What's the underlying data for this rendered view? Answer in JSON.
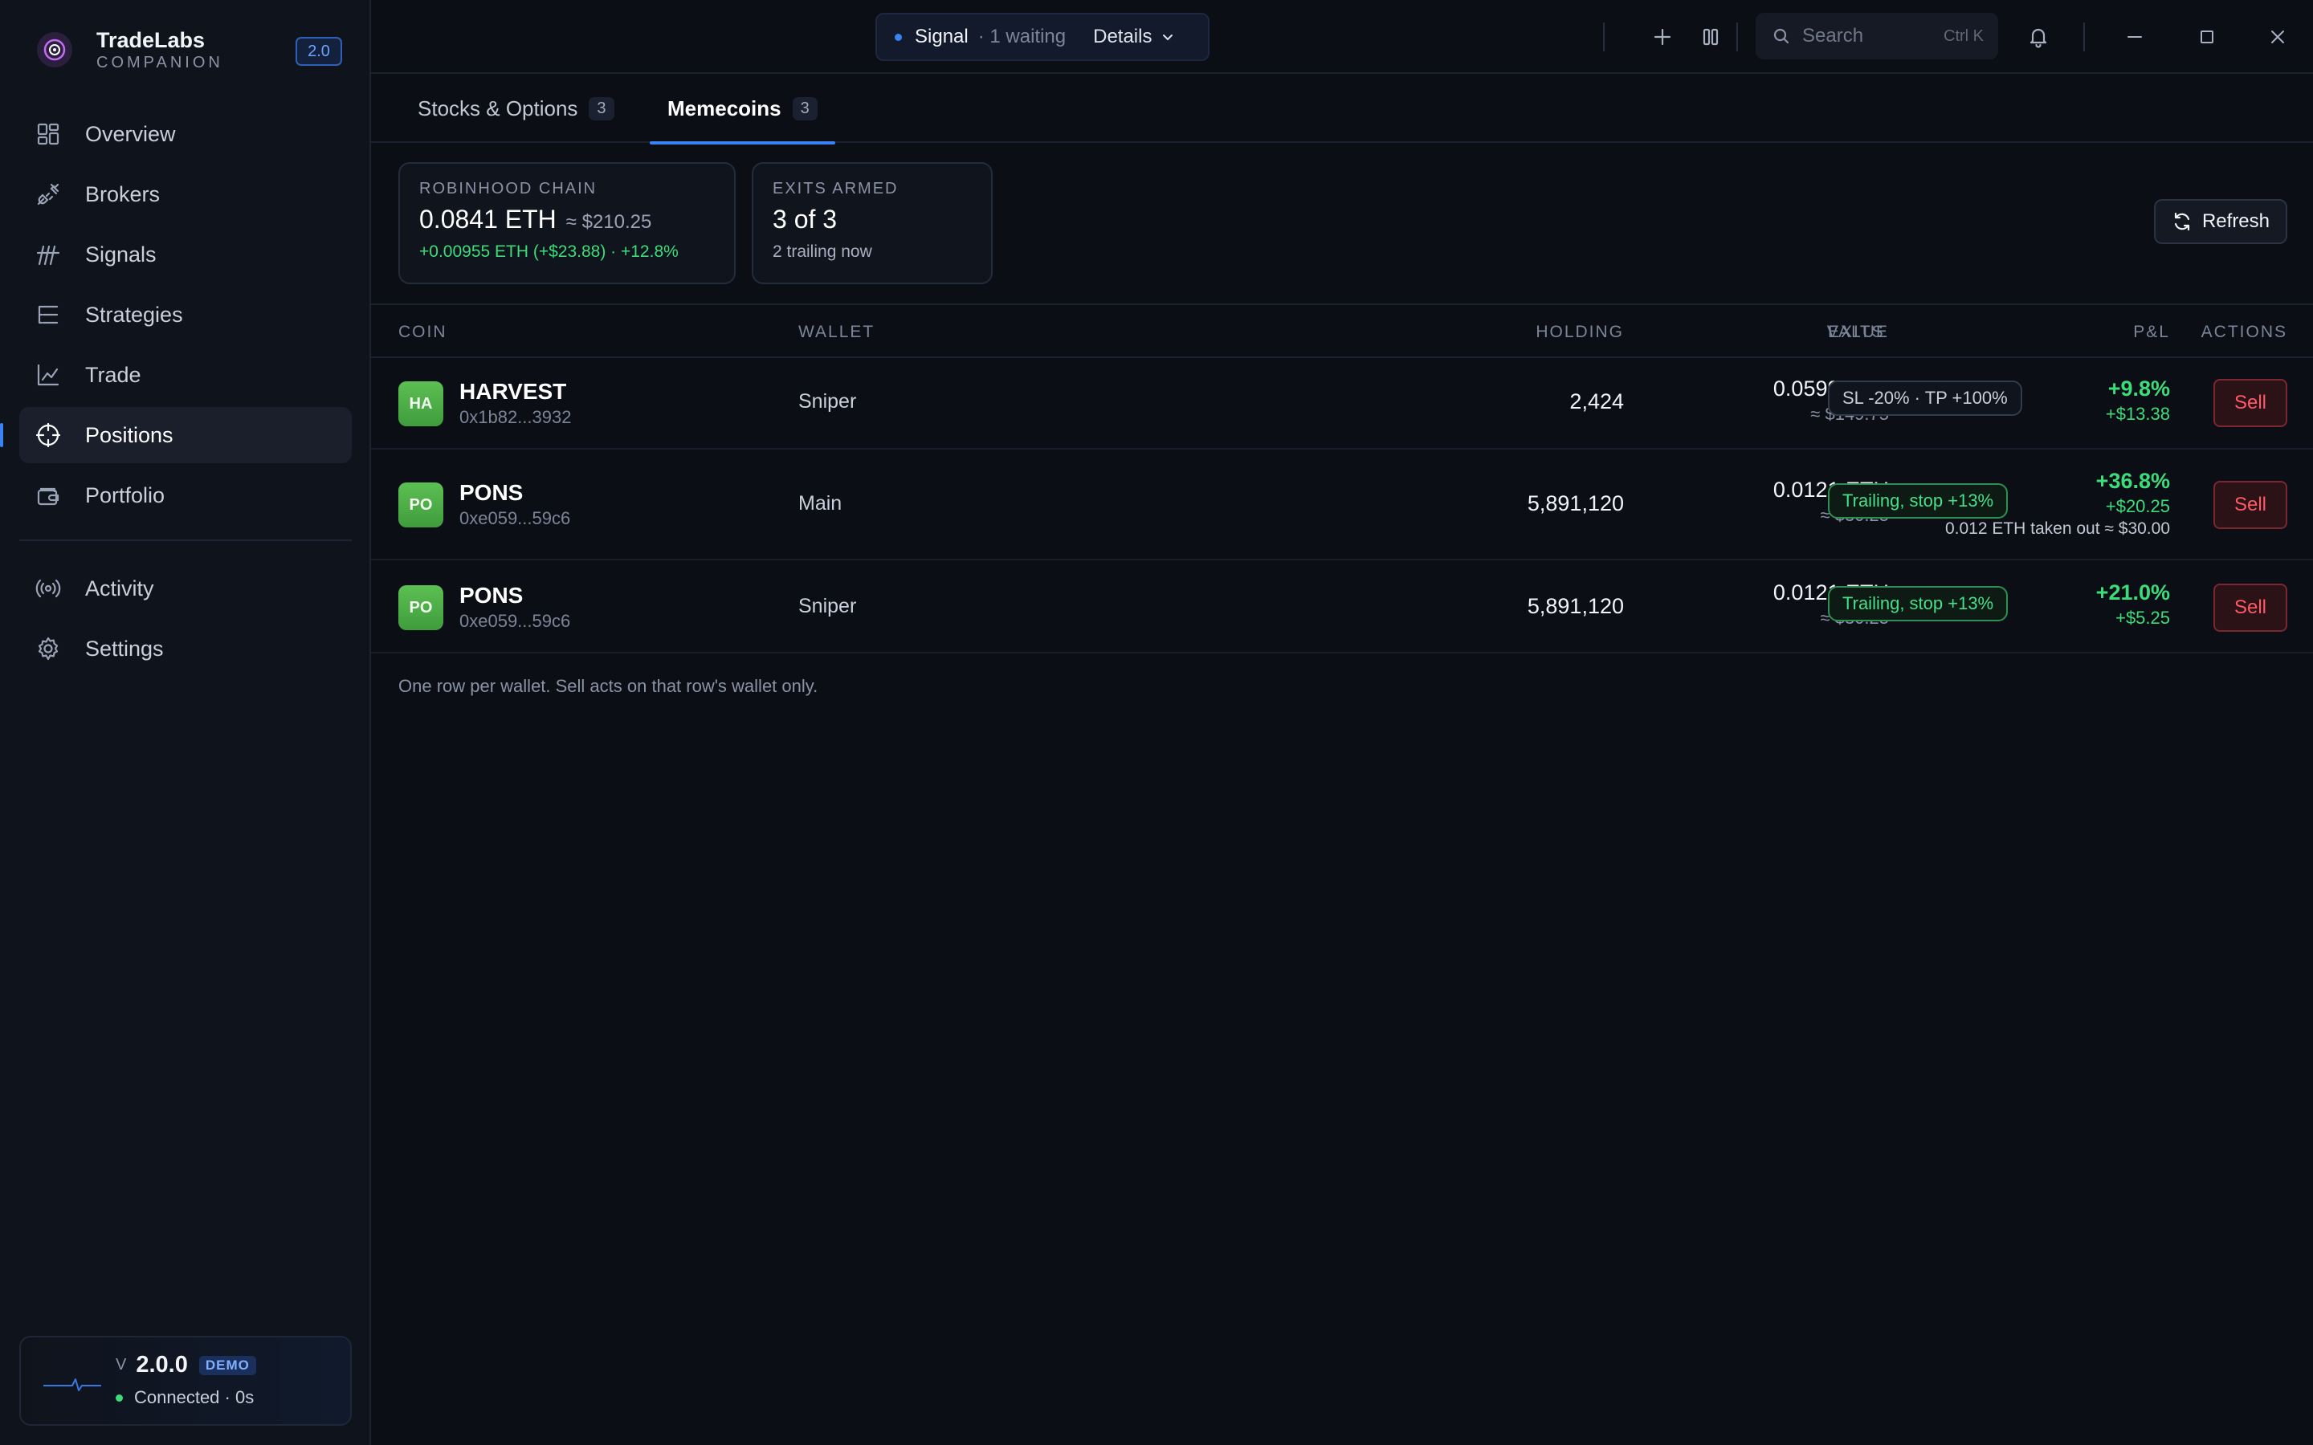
{
  "brand": {
    "name": "TradeLabs",
    "subtitle": "COMPANION",
    "version_badge": "2.0"
  },
  "sidebar": {
    "items": [
      {
        "label": "Overview",
        "icon": "grid-icon"
      },
      {
        "label": "Brokers",
        "icon": "plug-icon"
      },
      {
        "label": "Signals",
        "icon": "signal-icon"
      },
      {
        "label": "Strategies",
        "icon": "list-tree-icon"
      },
      {
        "label": "Trade",
        "icon": "line-chart-icon"
      },
      {
        "label": "Positions",
        "icon": "crosshair-icon",
        "active": true
      },
      {
        "label": "Portfolio",
        "icon": "wallet-icon"
      }
    ],
    "secondary": [
      {
        "label": "Activity",
        "icon": "broadcast-icon"
      },
      {
        "label": "Settings",
        "icon": "gear-icon"
      }
    ],
    "status": {
      "v_prefix": "V",
      "version": "2.0.0",
      "badge": "DEMO",
      "connection": "Connected · 0s"
    }
  },
  "topbar": {
    "signal_label": "Signal",
    "signal_waiting": "· 1 waiting",
    "details_label": "Details",
    "search_placeholder": "Search",
    "search_shortcut": "Ctrl K"
  },
  "tabs": [
    {
      "label": "Stocks & Options",
      "count": "3"
    },
    {
      "label": "Memecoins",
      "count": "3",
      "active": true
    }
  ],
  "summary": {
    "chain": {
      "title": "ROBINHOOD CHAIN",
      "amount": "0.0841 ETH",
      "approx": "≈ $210.25",
      "change": "+0.00955 ETH (+$23.88) · +12.8%"
    },
    "exits": {
      "title": "EXITS ARMED",
      "value": "3 of 3",
      "sub": "2 trailing now"
    }
  },
  "refresh_label": "Refresh",
  "table": {
    "columns": {
      "coin": "COIN",
      "wallet": "WALLET",
      "holding": "HOLDING",
      "value": "VALUE",
      "pnl": "P&L",
      "exits": "EXITS",
      "actions": "ACTIONS"
    },
    "rows": [
      {
        "avatar": "HA",
        "coin": "HARVEST",
        "address": "0x1b82...3932",
        "wallet": "Sniper",
        "holding": "2,424",
        "value_eth": "0.0599 ETH",
        "value_usd": "≈ $149.75",
        "pnl_pct": "+9.8%",
        "pnl_usd": "+$13.38",
        "pnl_note": "",
        "exit": "SL -20% · TP +100%",
        "exit_style": "neutral",
        "action": "Sell"
      },
      {
        "avatar": "PO",
        "coin": "PONS",
        "address": "0xe059...59c6",
        "wallet": "Main",
        "holding": "5,891,120",
        "value_eth": "0.0121 ETH",
        "value_usd": "≈ $30.25",
        "pnl_pct": "+36.8%",
        "pnl_usd": "+$20.25",
        "pnl_note": "0.012 ETH taken out ≈ $30.00",
        "exit": "Trailing, stop +13%",
        "exit_style": "trailing",
        "action": "Sell"
      },
      {
        "avatar": "PO",
        "coin": "PONS",
        "address": "0xe059...59c6",
        "wallet": "Sniper",
        "holding": "5,891,120",
        "value_eth": "0.0121 ETH",
        "value_usd": "≈ $30.25",
        "pnl_pct": "+21.0%",
        "pnl_usd": "+$5.25",
        "pnl_note": "",
        "exit": "Trailing, stop +13%",
        "exit_style": "trailing",
        "action": "Sell"
      }
    ],
    "footnote": "One row per wallet. Sell acts on that row's wallet only."
  }
}
